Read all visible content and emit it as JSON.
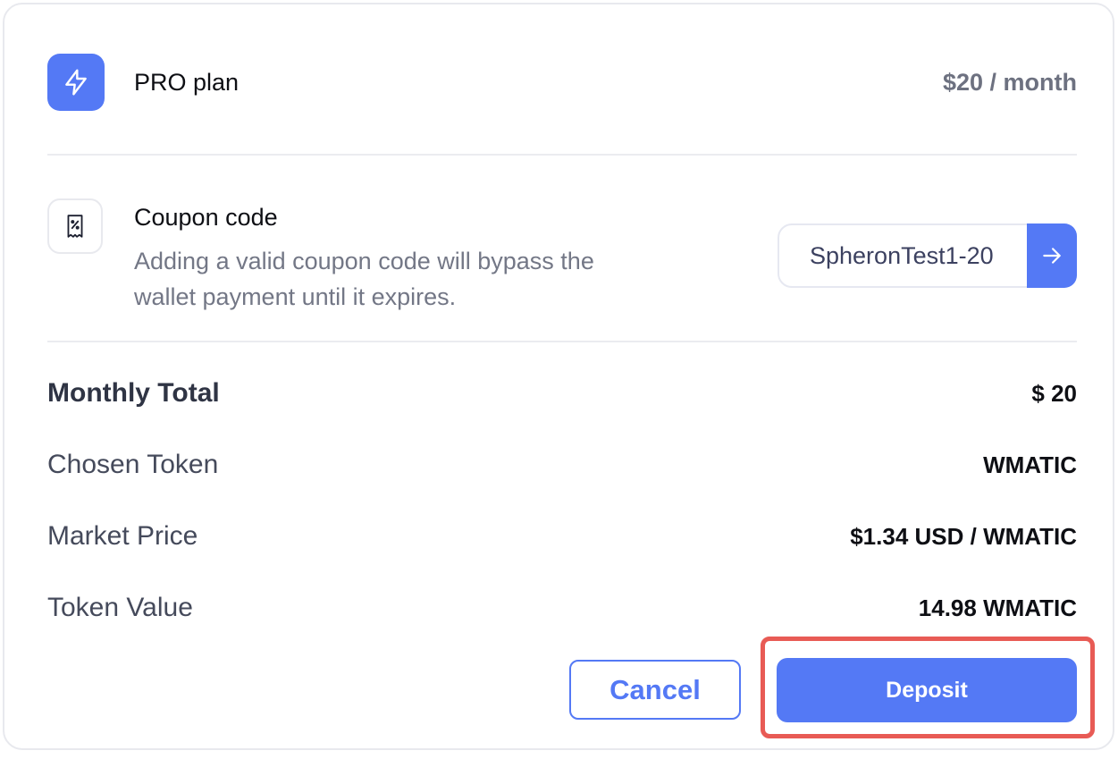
{
  "plan": {
    "icon": "lightning-icon",
    "name": "PRO plan",
    "price": "$20 / month"
  },
  "coupon": {
    "icon": "discount-receipt-icon",
    "title": "Coupon code",
    "description": "Adding a valid coupon code will bypass the wallet payment until it expires.",
    "value": "SpheronTest1-20",
    "submit_icon": "arrow-right-icon"
  },
  "summary": {
    "rows": [
      {
        "label": "Monthly Total",
        "value": "$ 20"
      },
      {
        "label": "Chosen Token",
        "value": "WMATIC"
      },
      {
        "label": "Market Price",
        "value": "$1.34 USD / WMATIC"
      },
      {
        "label": "Token Value",
        "value": "14.98 WMATIC"
      }
    ]
  },
  "actions": {
    "cancel_label": "Cancel",
    "deposit_label": "Deposit"
  },
  "colors": {
    "accent": "#5479f5",
    "highlight": "#e85b55"
  }
}
